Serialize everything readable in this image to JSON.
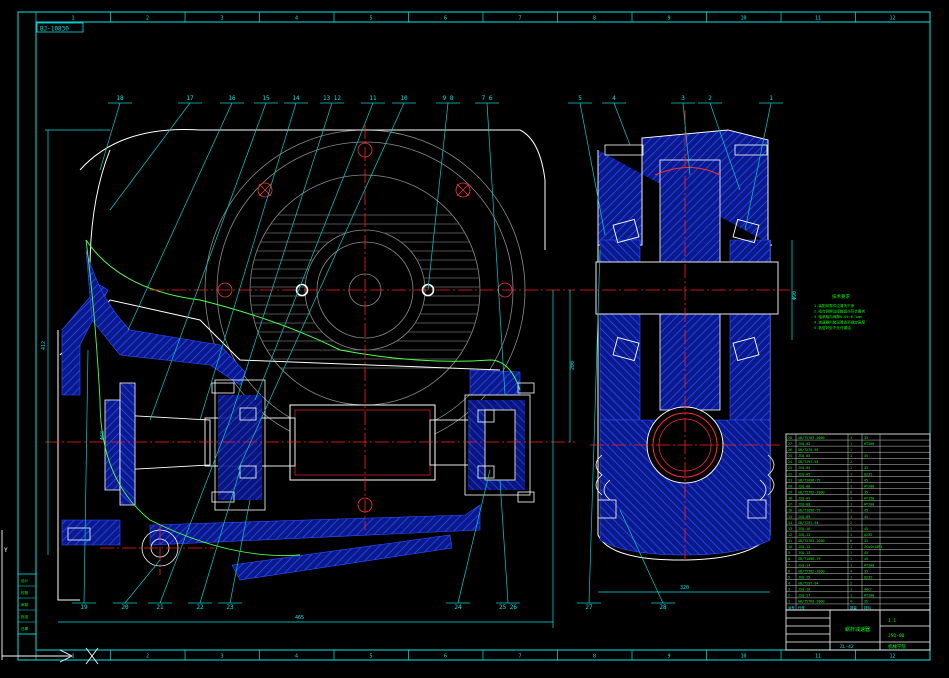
{
  "colors": {
    "background": "#000000",
    "frame": "#00e5e5",
    "outline": "#ffffff",
    "hatch": "#1a2fd6",
    "centerline": "#ff2020",
    "leader": "#00d0d0",
    "note": "#00ff00",
    "curve": "#4cff4c"
  },
  "sheet": {
    "grid_top": [
      "1",
      "2",
      "3",
      "4",
      "5",
      "6",
      "7",
      "8",
      "9",
      "10",
      "11",
      "12"
    ],
    "grid_bottom": [
      "1",
      "2",
      "3",
      "4",
      "5",
      "6",
      "7",
      "8",
      "9",
      "10",
      "11",
      "12"
    ],
    "drawing_code": "BJ-10830",
    "sheet_label": "ZL-42"
  },
  "balloons_front": [
    "18",
    "17",
    "16",
    "15",
    "14",
    "13 12",
    "11",
    "10",
    "9 8",
    "7 6"
  ],
  "balloons_bottom": [
    "19",
    "20",
    "21",
    "22",
    "23",
    "24",
    "25 26"
  ],
  "balloons_side_top": [
    "5",
    "4",
    "3",
    "2",
    "1"
  ],
  "balloons_side_bottom": [
    "27",
    "28"
  ],
  "dimensions": {
    "overall_length": "465",
    "side_width": "320",
    "center_height": "200",
    "shaft_dia": "Φ68",
    "left_height": "412",
    "right_height": "Φ90"
  },
  "tech_notes": {
    "title": "技术要求",
    "lines": [
      "1.装配前零件应清洗干净",
      "2.啮合侧隙及接触斑点符合要求",
      "3.轴承轴向间隙0.05~0.1mm",
      "4.减速器内装润滑油至规定高度",
      "5.各密封处不允许漏油"
    ]
  },
  "parts_list": {
    "rows": [
      [
        "28",
        "GB/T5783-2000",
        "1",
        "35"
      ],
      [
        "27",
        "JSQ-02",
        "1",
        "HT200"
      ],
      [
        "26",
        "GB/T276-94",
        "1",
        ""
      ],
      [
        "25",
        "JSQ-03",
        "1",
        "45"
      ],
      [
        "24",
        "GB/T297-94",
        "2",
        ""
      ],
      [
        "23",
        "JSQ-04",
        "1",
        "45"
      ],
      [
        "22",
        "JSQ-05",
        "1",
        "Q235"
      ],
      [
        "21",
        "GB/T1096-79",
        "1",
        "45"
      ],
      [
        "20",
        "JSQ-06",
        "1",
        "HT200"
      ],
      [
        "19",
        "GB/T5782-2000",
        "8",
        "35"
      ],
      [
        "18",
        "JSQ-07",
        "1",
        "HT150"
      ],
      [
        "17",
        "JSQ-08",
        "1",
        "HT200"
      ],
      [
        "16",
        "GB/T1096-79",
        "1",
        "45"
      ],
      [
        "15",
        "JSQ-09",
        "1",
        "45"
      ],
      [
        "14",
        "GB/T297-94",
        "2",
        ""
      ],
      [
        "13",
        "JSQ-10",
        "1",
        "45"
      ],
      [
        "12",
        "JSQ-11",
        "1",
        "Q235"
      ],
      [
        "11",
        "GB/T5783-2000",
        "6",
        "35"
      ],
      [
        "10",
        "JSQ-12",
        "1",
        "ZCuSn10P1"
      ],
      [
        "9",
        "JSQ-13",
        "1",
        "45"
      ],
      [
        "8",
        "GB/T1096-79",
        "1",
        "45"
      ],
      [
        "7",
        "JSQ-14",
        "1",
        "HT200"
      ],
      [
        "6",
        "GB/T5782-2000",
        "4",
        "35"
      ],
      [
        "5",
        "JSQ-15",
        "1",
        "Q235"
      ],
      [
        "4",
        "GB/T297-94",
        "2",
        ""
      ],
      [
        "3",
        "JSQ-16",
        "1",
        "40Cr"
      ],
      [
        "2",
        "JSQ-17",
        "1",
        "HT200"
      ],
      [
        "1",
        "GB/T5783-2000",
        "4",
        "35"
      ]
    ],
    "header": [
      "序号",
      "代号",
      "数量",
      "材料"
    ]
  },
  "title_block": {
    "name": "蜗杆减速器",
    "scale": "1:1",
    "drawing_no": "JSQ-00",
    "school": "机械学院"
  },
  "left_table": {
    "rows": [
      "设计",
      "校核",
      "审核",
      "批准",
      "日期"
    ]
  },
  "ucs": {
    "x_label": "X",
    "y_label": "Y"
  }
}
